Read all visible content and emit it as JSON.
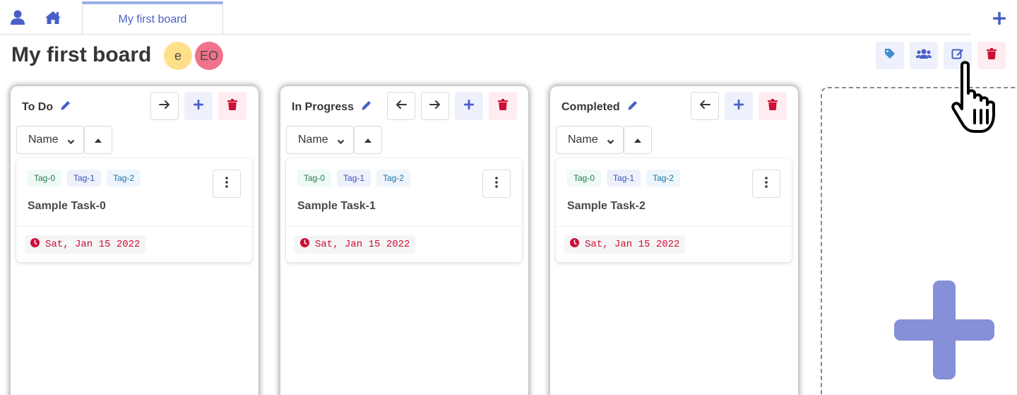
{
  "nav": {
    "user_icon": "user-icon",
    "home_icon": "home-icon",
    "add_board_icon": "plus-icon"
  },
  "tabs": [
    {
      "label": "My first board",
      "active": true
    }
  ],
  "board": {
    "title": "My first board",
    "members": [
      {
        "initials": "e",
        "color": "#ffe08a"
      },
      {
        "initials": "EO",
        "color": "#f14668"
      }
    ],
    "actions": [
      {
        "icon": "tag-icon",
        "color": "#3e8ed0"
      },
      {
        "icon": "users-icon",
        "color": "#485fc7"
      },
      {
        "icon": "edit-icon",
        "color": "#485fc7"
      },
      {
        "icon": "trash-icon",
        "color": "#f14668"
      }
    ]
  },
  "columns": [
    {
      "title": "To Do",
      "sort_by": "Name",
      "cards": [
        {
          "title": "Sample Task-0",
          "tags": [
            "Tag-0",
            "Tag-1",
            "Tag-2"
          ],
          "due": "Sat, Jan 15 2022"
        }
      ]
    },
    {
      "title": "In Progress",
      "sort_by": "Name",
      "cards": [
        {
          "title": "Sample Task-1",
          "tags": [
            "Tag-0",
            "Tag-1",
            "Tag-2"
          ],
          "due": "Sat, Jan 15 2022"
        }
      ]
    },
    {
      "title": "Completed",
      "sort_by": "Name",
      "cards": [
        {
          "title": "Sample Task-2",
          "tags": [
            "Tag-0",
            "Tag-1",
            "Tag-2"
          ],
          "due": "Sat, Jan 15 2022"
        }
      ]
    }
  ],
  "colors": {
    "primary": "#485fc7",
    "danger": "#f14668",
    "due_text": "#cc0f35",
    "add_column_plus": "#8590d8"
  }
}
